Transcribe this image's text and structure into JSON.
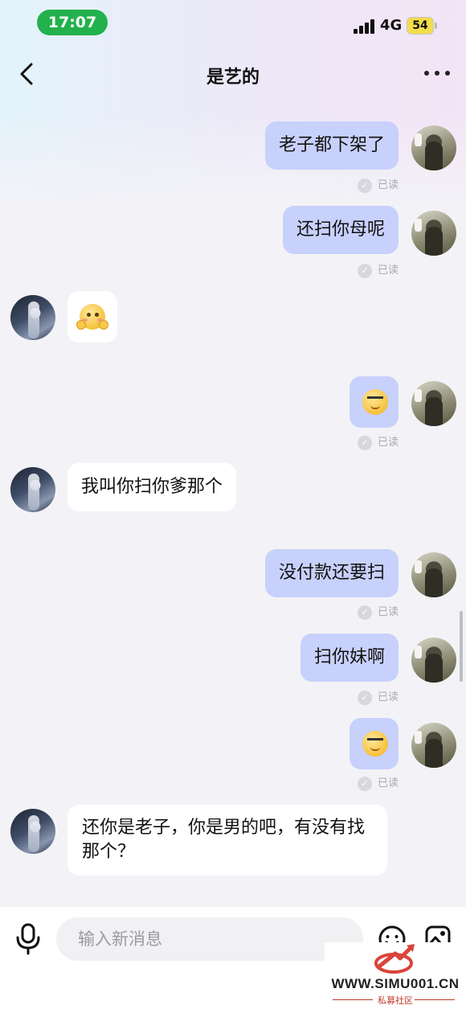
{
  "status_bar": {
    "time": "17:07",
    "network": "4G",
    "battery": "54",
    "accent_color": "#22b14c"
  },
  "header": {
    "title": "是艺的",
    "back_icon": "chevron-left-icon",
    "more_icon": "more-dots-icon"
  },
  "messages": [
    {
      "side": "out",
      "type": "text",
      "text": "老子都下架了",
      "read": "已读"
    },
    {
      "side": "out",
      "type": "text",
      "text": "还扫你母呢",
      "read": "已读"
    },
    {
      "side": "in",
      "type": "emoji",
      "emoji": "shy-face-emoji"
    },
    {
      "side": "out",
      "type": "emoji",
      "emoji": "cool-face-emoji",
      "read": "已读"
    },
    {
      "side": "in",
      "type": "text",
      "text": "我叫你扫你爹那个"
    },
    {
      "side": "out",
      "type": "text",
      "text": "没付款还要扫",
      "read": "已读"
    },
    {
      "side": "out",
      "type": "text",
      "text": "扫你妹啊",
      "read": "已读"
    },
    {
      "side": "out",
      "type": "emoji",
      "emoji": "cool-face-emoji",
      "read": "已读"
    },
    {
      "side": "in",
      "type": "text",
      "text": "还你是老子，你是男的吧，有没有找那个？"
    }
  ],
  "colors": {
    "outgoing_bubble": "#c8d1fb",
    "incoming_bubble": "#ffffff",
    "background": "#f3f3f7"
  },
  "composer": {
    "placeholder": "输入新消息",
    "mic_icon": "microphone-icon",
    "emoji_icon": "emoji-icon",
    "image_icon": "image-icon"
  },
  "watermark": {
    "url": "WWW.SIMU001.CN",
    "subtitle": "私募社区"
  }
}
